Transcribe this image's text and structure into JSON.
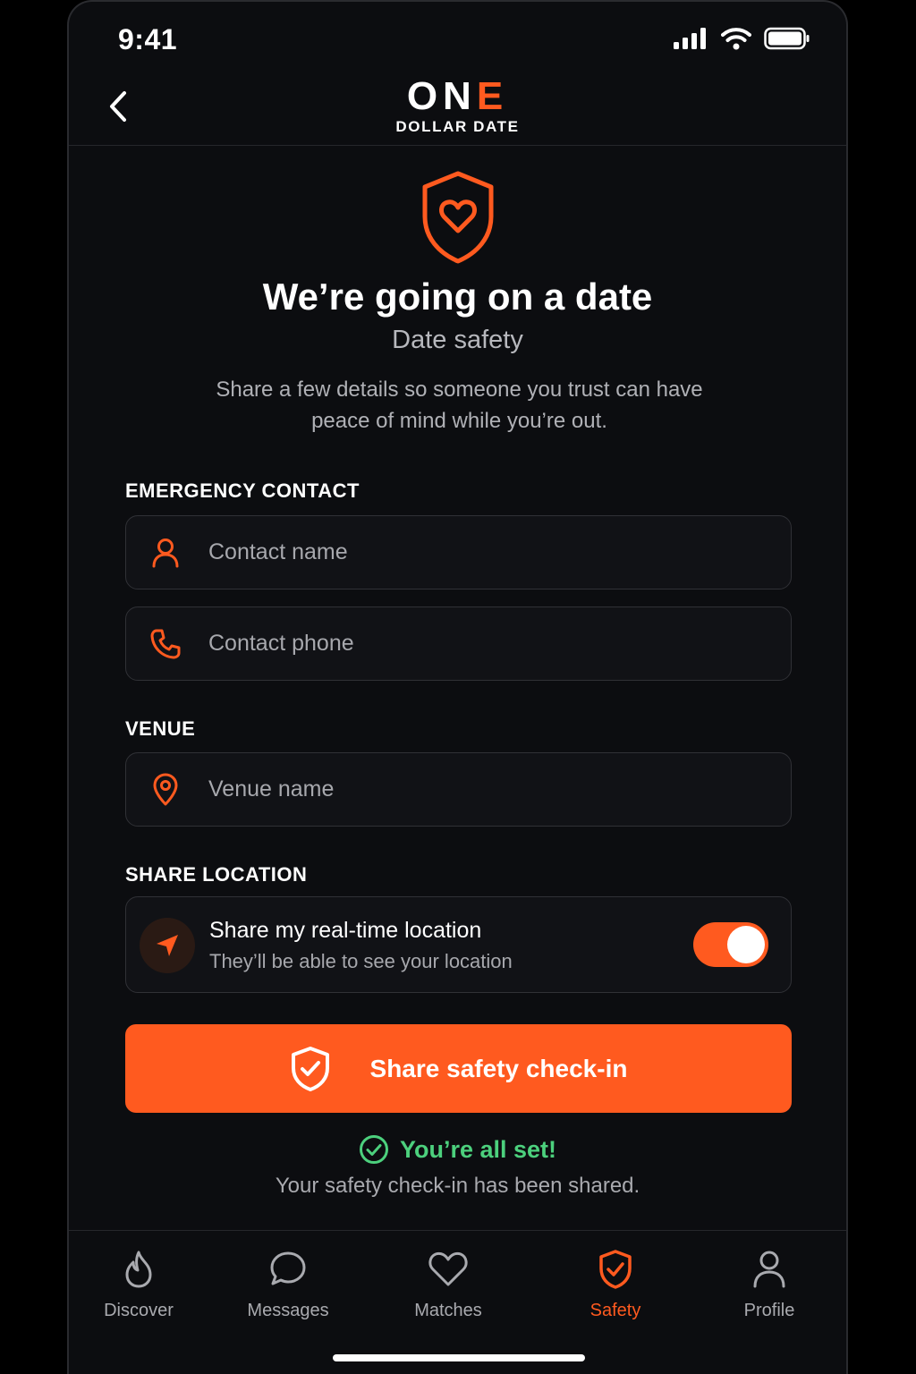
{
  "status_bar": {
    "time": "9:41"
  },
  "header": {
    "logo_main_prefix": "ON",
    "logo_main_accent": "E",
    "logo_sub": "DOLLAR DATE"
  },
  "hero": {
    "title": "We’re going on a date",
    "subtitle": "Date safety",
    "description": "Share a few details so someone you trust can have peace of mind while you’re out."
  },
  "emergency_contact": {
    "label": "EMERGENCY CONTACT",
    "name_placeholder": "Contact name",
    "phone_placeholder": "Contact phone"
  },
  "venue": {
    "label": "VENUE",
    "placeholder": "Venue name"
  },
  "share_location": {
    "label": "SHARE LOCATION",
    "title": "Share my real-time location",
    "subtitle": "They’ll be able to see your location",
    "enabled": true
  },
  "cta": {
    "label": "Share safety check-in"
  },
  "confirmation": {
    "title": "You’re all set!",
    "message": "Your safety check-in has been shared."
  },
  "tabs": [
    {
      "label": "Discover",
      "icon": "flame-icon"
    },
    {
      "label": "Messages",
      "icon": "chat-bubble-icon"
    },
    {
      "label": "Matches",
      "icon": "heart-icon"
    },
    {
      "label": "Safety",
      "icon": "shield-check-icon",
      "active": true
    },
    {
      "label": "Profile",
      "icon": "person-icon"
    }
  ],
  "colors": {
    "accent": "#ff5a1f",
    "success": "#4cd07d",
    "background": "#0c0d10"
  }
}
